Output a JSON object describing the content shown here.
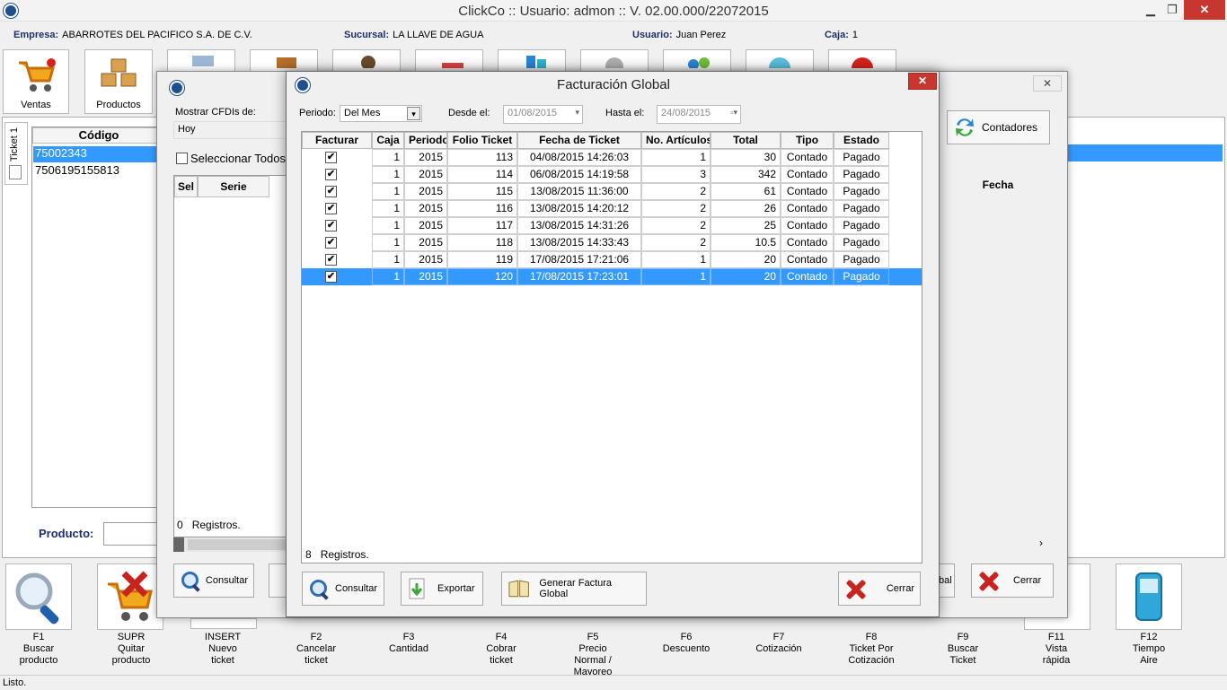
{
  "window": {
    "title": "ClickCo :: Usuario: admon :: V. 02.00.000/22072015",
    "minimize": "▁",
    "maximize": "❐",
    "close": "✕"
  },
  "info": {
    "empresa_label": "Empresa:",
    "empresa": "ABARROTES DEL PACIFICO S.A. DE C.V.",
    "sucursal_label": "Sucursal:",
    "sucursal": "LA LLAVE DE AGUA",
    "usuario_label": "Usuario:",
    "usuario": "Juan Perez",
    "caja_label": "Caja:",
    "caja": "1"
  },
  "toolbar": {
    "ventas": "Ventas",
    "productos": "Productos"
  },
  "main": {
    "ticket_tab": "Ticket 1",
    "codigo_header": "Código",
    "codes": [
      "75002343",
      "7506195155813"
    ],
    "producto_label": "Producto:"
  },
  "cfdi": {
    "mostrar_label": "Mostrar CFDIs de:",
    "mostrar_value": "Hoy",
    "seleccionar_todos": "Seleccionar Todos",
    "col_sel": "Sel",
    "col_serie": "Serie",
    "col_fecha": "Fecha",
    "registros_count": "0",
    "registros_label": "Registros.",
    "contadores": "Contadores",
    "consultar": "Consultar",
    "cerrar": "Cerrar",
    "partial_label": "bal"
  },
  "fg": {
    "title": "Facturación Global",
    "close": "✕",
    "periodo_label": "Periodo:",
    "periodo_value": "Del Mes",
    "desde_label": "Desde el:",
    "desde_value": "01/08/2015",
    "hasta_label": "Hasta el:",
    "hasta_value": "24/08/2015",
    "headers": [
      "Facturar",
      "Caja",
      "Periodo",
      "Folio Ticket",
      "Fecha de Ticket",
      "No. Artículos",
      "Total",
      "Tipo",
      "Estado"
    ],
    "rows": [
      {
        "checked": true,
        "caja": "1",
        "periodo": "2015",
        "folio": "113",
        "fecha": "04/08/2015 14:26:03",
        "articulos": "1",
        "total": "30",
        "tipo": "Contado",
        "estado": "Pagado"
      },
      {
        "checked": true,
        "caja": "1",
        "periodo": "2015",
        "folio": "114",
        "fecha": "06/08/2015 14:19:58",
        "articulos": "3",
        "total": "342",
        "tipo": "Contado",
        "estado": "Pagado"
      },
      {
        "checked": true,
        "caja": "1",
        "periodo": "2015",
        "folio": "115",
        "fecha": "13/08/2015 11:36:00",
        "articulos": "2",
        "total": "61",
        "tipo": "Contado",
        "estado": "Pagado"
      },
      {
        "checked": true,
        "caja": "1",
        "periodo": "2015",
        "folio": "116",
        "fecha": "13/08/2015 14:20:12",
        "articulos": "2",
        "total": "26",
        "tipo": "Contado",
        "estado": "Pagado"
      },
      {
        "checked": true,
        "caja": "1",
        "periodo": "2015",
        "folio": "117",
        "fecha": "13/08/2015 14:31:26",
        "articulos": "2",
        "total": "25",
        "tipo": "Contado",
        "estado": "Pagado"
      },
      {
        "checked": true,
        "caja": "1",
        "periodo": "2015",
        "folio": "118",
        "fecha": "13/08/2015 14:33:43",
        "articulos": "2",
        "total": "10.5",
        "tipo": "Contado",
        "estado": "Pagado"
      },
      {
        "checked": true,
        "caja": "1",
        "periodo": "2015",
        "folio": "119",
        "fecha": "17/08/2015 17:21:06",
        "articulos": "1",
        "total": "20",
        "tipo": "Contado",
        "estado": "Pagado"
      },
      {
        "checked": true,
        "caja": "1",
        "periodo": "2015",
        "folio": "120",
        "fecha": "17/08/2015 17:23:01",
        "articulos": "1",
        "total": "20",
        "tipo": "Contado",
        "estado": "Pagado"
      }
    ],
    "registros_count": "8",
    "registros_label": "Registros.",
    "consultar": "Consultar",
    "exportar": "Exportar",
    "generar": "Generar Factura Global",
    "cerrar": "Cerrar"
  },
  "fkeys": [
    {
      "key": "F1",
      "label": "Buscar producto"
    },
    {
      "key": "SUPR",
      "label": "Quitar producto"
    },
    {
      "key": "INSERT",
      "label": "Nuevo ticket"
    },
    {
      "key": "F2",
      "label": "Cancelar ticket"
    },
    {
      "key": "F3",
      "label": "Cantidad"
    },
    {
      "key": "F4",
      "label": "Cobrar ticket"
    },
    {
      "key": "F5",
      "label": "Precio Normal / Mayoreo"
    },
    {
      "key": "F6",
      "label": "Descuento"
    },
    {
      "key": "F7",
      "label": "Cotización"
    },
    {
      "key": "F8",
      "label": "Ticket Por Cotización"
    },
    {
      "key": "F9",
      "label": "Buscar Ticket"
    },
    {
      "key": "F11",
      "label": "Vista rápida"
    },
    {
      "key": "F12",
      "label": "Tiempo Aire"
    }
  ],
  "status": "Listo.",
  "colors": {
    "selection": "#3399ff",
    "close_red": "#c7372f",
    "label_blue": "#1b2f6b"
  }
}
